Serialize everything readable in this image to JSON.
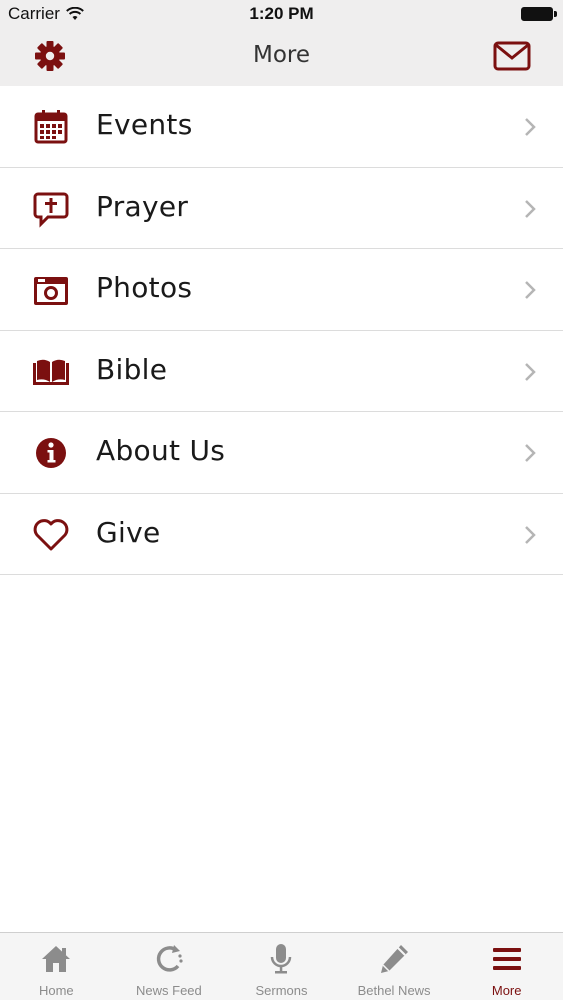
{
  "status": {
    "carrier": "Carrier",
    "time": "1:20 PM"
  },
  "nav": {
    "title": "More",
    "left_icon": "gear-icon",
    "right_icon": "mail-icon"
  },
  "colors": {
    "accent": "#7b1010",
    "inactive": "#8c8c8c",
    "bar_bg": "#efeeee"
  },
  "menu": {
    "items": [
      {
        "label": "Events",
        "icon": "calendar-icon"
      },
      {
        "label": "Prayer",
        "icon": "prayer-cross-bubble-icon"
      },
      {
        "label": "Photos",
        "icon": "camera-icon"
      },
      {
        "label": "Bible",
        "icon": "open-book-icon"
      },
      {
        "label": "About Us",
        "icon": "info-icon"
      },
      {
        "label": "Give",
        "icon": "heart-icon"
      }
    ]
  },
  "tabs": [
    {
      "label": "Home",
      "icon": "home-icon",
      "active": false
    },
    {
      "label": "News Feed",
      "icon": "refresh-icon",
      "active": false
    },
    {
      "label": "Sermons",
      "icon": "microphone-icon",
      "active": false
    },
    {
      "label": "Bethel News",
      "icon": "pencil-icon",
      "active": false
    },
    {
      "label": "More",
      "icon": "menu-lines-icon",
      "active": true
    }
  ]
}
